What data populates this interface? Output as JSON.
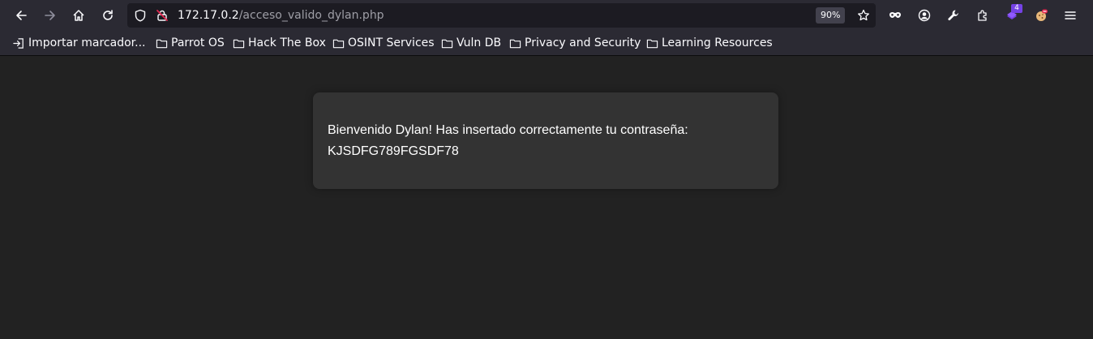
{
  "browser": {
    "url_host": "172.17.0.2",
    "url_path": "/acceso_valido_dylan.php",
    "zoom": "90%",
    "extension_badge": "4",
    "nav_icons": [
      "back-icon",
      "forward-icon",
      "home-icon",
      "reload-icon"
    ],
    "toolbar_icons": [
      "private-browsing-icon",
      "account-icon",
      "wrench-icon",
      "extensions-icon",
      "hackbar-extension-icon",
      "cookie-extension-icon",
      "menu-icon"
    ]
  },
  "bookmarks": {
    "items": [
      {
        "label": "Importar marcador..."
      },
      {
        "label": "Parrot OS"
      },
      {
        "label": "Hack The Box"
      },
      {
        "label": "OSINT Services"
      },
      {
        "label": "Vuln DB"
      },
      {
        "label": "Privacy and Security"
      },
      {
        "label": "Learning Resources"
      }
    ]
  },
  "page": {
    "message": "Bienvenido Dylan! Has insertado correctamente tu contraseña:",
    "password": "KJSDFG789FGSDF78"
  },
  "colors": {
    "toolbar": "#2b2a33",
    "urlbar": "#1c1b22",
    "page_bg": "#222222",
    "card_bg": "#333333",
    "text": "#fbfbfe",
    "insecure_red": "#e22850"
  }
}
